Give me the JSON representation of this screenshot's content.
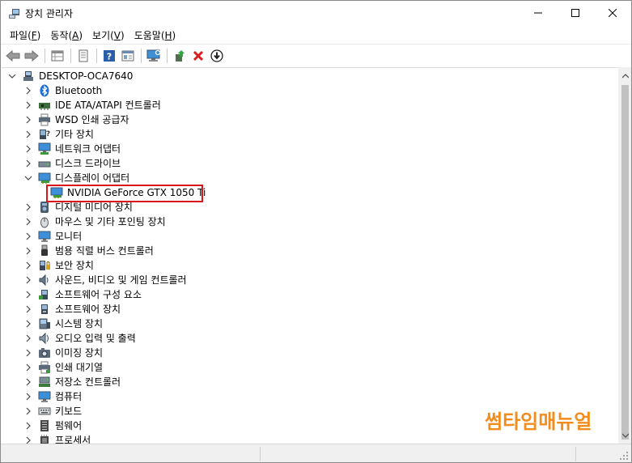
{
  "window": {
    "title": "장치 관리자",
    "icon": "device-manager-icon"
  },
  "title_buttons": {
    "minimize_icon": "minimize-icon",
    "maximize_icon": "maximize-icon",
    "close_icon": "close-icon"
  },
  "menu": [
    {
      "label": "파일(",
      "acc": "F",
      "end": ")"
    },
    {
      "label": "동작(",
      "acc": "A",
      "end": ")"
    },
    {
      "label": "보기(",
      "acc": "V",
      "end": ")"
    },
    {
      "label": "도움말(",
      "acc": "H",
      "end": ")"
    }
  ],
  "toolbar": [
    {
      "name": "back-icon"
    },
    {
      "name": "forward-icon"
    },
    {
      "name": "sep"
    },
    {
      "name": "properties-grid-icon"
    },
    {
      "name": "sep"
    },
    {
      "name": "document-icon"
    },
    {
      "name": "sep"
    },
    {
      "name": "help-icon"
    },
    {
      "name": "view-resources-icon"
    },
    {
      "name": "sep"
    },
    {
      "name": "scan-monitor-icon"
    },
    {
      "name": "sep"
    },
    {
      "name": "update-driver-icon"
    },
    {
      "name": "uninstall-icon"
    },
    {
      "name": "download-circle-icon"
    }
  ],
  "tree": {
    "root": {
      "label": "DESKTOP-OCA7640",
      "icon": "computer-icon",
      "expanded": true
    },
    "items": [
      {
        "label": "Bluetooth",
        "icon": "bluetooth-icon",
        "expanded": false
      },
      {
        "label": "IDE ATA/ATAPI 컨트롤러",
        "icon": "ide-controller-icon",
        "expanded": false
      },
      {
        "label": "WSD 인쇄 공급자",
        "icon": "printer-icon",
        "expanded": false
      },
      {
        "label": "기타 장치",
        "icon": "unknown-device-icon",
        "expanded": false
      },
      {
        "label": "네트워크 어댑터",
        "icon": "network-adapter-icon",
        "expanded": false
      },
      {
        "label": "디스크 드라이브",
        "icon": "disk-drive-icon",
        "expanded": false
      },
      {
        "label": "디스플레이 어댑터",
        "icon": "display-adapter-icon",
        "expanded": true,
        "children": [
          {
            "label": "NVIDIA GeForce GTX 1050 Ti",
            "icon": "display-adapter-icon",
            "highlighted": true
          }
        ]
      },
      {
        "label": "디지털 미디어 장치",
        "icon": "digital-media-icon",
        "expanded": false
      },
      {
        "label": "마우스 및 기타 포인팅 장치",
        "icon": "mouse-icon",
        "expanded": false
      },
      {
        "label": "모니터",
        "icon": "monitor-icon",
        "expanded": false
      },
      {
        "label": "범용 직렬 버스 컨트롤러",
        "icon": "usb-icon",
        "expanded": false
      },
      {
        "label": "보안 장치",
        "icon": "security-device-icon",
        "expanded": false
      },
      {
        "label": "사운드, 비디오 및 게임 컨트롤러",
        "icon": "sound-icon",
        "expanded": false
      },
      {
        "label": "소프트웨어 구성 요소",
        "icon": "software-component-icon",
        "expanded": false
      },
      {
        "label": "소프트웨어 장치",
        "icon": "software-device-icon",
        "expanded": false
      },
      {
        "label": "시스템 장치",
        "icon": "system-device-icon",
        "expanded": false
      },
      {
        "label": "오디오 입력 및 출력",
        "icon": "audio-io-icon",
        "expanded": false
      },
      {
        "label": "이미징 장치",
        "icon": "camera-icon",
        "expanded": false
      },
      {
        "label": "인쇄 대기열",
        "icon": "print-queue-icon",
        "expanded": false
      },
      {
        "label": "저장소 컨트롤러",
        "icon": "storage-controller-icon",
        "expanded": false
      },
      {
        "label": "컴퓨터",
        "icon": "computer-monitor-icon",
        "expanded": false
      },
      {
        "label": "키보드",
        "icon": "keyboard-icon",
        "expanded": false
      },
      {
        "label": "펌웨어",
        "icon": "firmware-icon",
        "expanded": false
      },
      {
        "label": "프로세서",
        "icon": "processor-icon",
        "expanded": false
      }
    ]
  },
  "watermark": "썸타임매뉴얼",
  "colors": {
    "highlight_border": "#d9161c",
    "watermark": "#f28c1c",
    "monitor_blue": "#2f86d0"
  }
}
